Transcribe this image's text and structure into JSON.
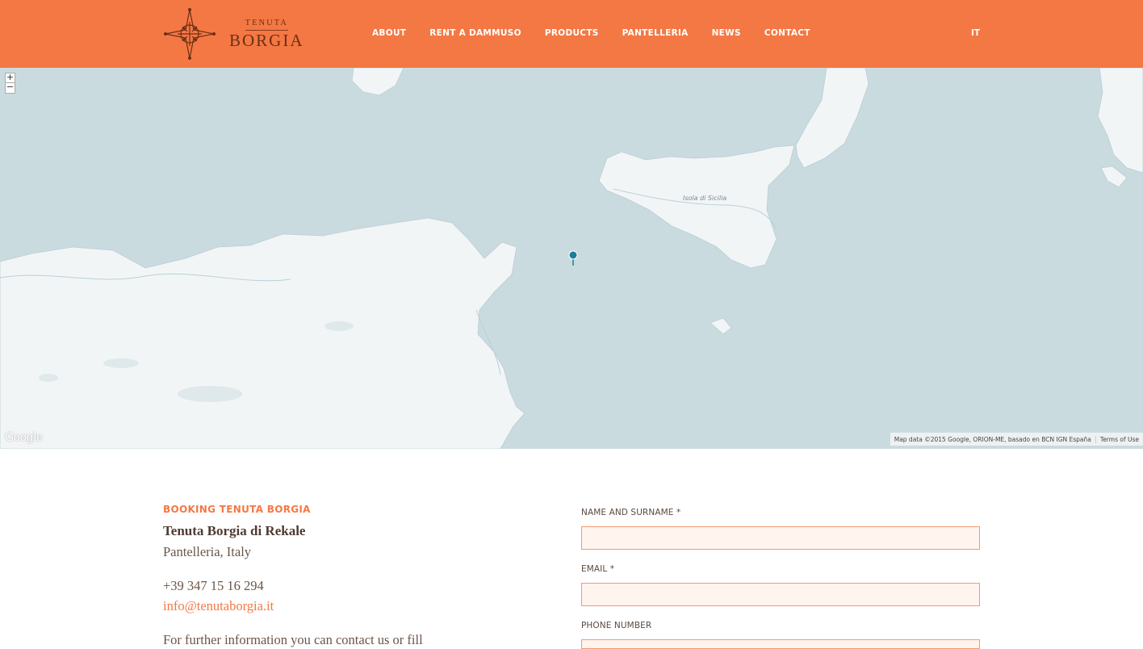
{
  "header": {
    "logo": {
      "top": "TENUTA",
      "bottom": "BORGIA"
    },
    "nav": [
      {
        "label": "ABOUT"
      },
      {
        "label": "RENT A DAMMUSO"
      },
      {
        "label": "PRODUCTS"
      },
      {
        "label": "PANTELLERIA"
      },
      {
        "label": "NEWS"
      },
      {
        "label": "CONTACT"
      }
    ],
    "language": "IT",
    "colors": {
      "brand": "#f47844",
      "logo": "#6b2e14"
    }
  },
  "map": {
    "zoom_in": "+",
    "zoom_out": "−",
    "place_label": "Isola di Sicilia",
    "provider": "Google",
    "credits": "Map data ©2015 Google, ORION-ME, basado en BCN IGN España",
    "terms": "Terms of Use",
    "marker_icon": "map-pin-icon",
    "colors": {
      "water": "#cadbe0",
      "land": "#f2f5f6",
      "marker": "#1a7f9a"
    }
  },
  "booking": {
    "title": "BOOKING TENUTA BORGIA",
    "company": "Tenuta Borgia di Rekale",
    "location": "Pantelleria, Italy",
    "phone": "+39 347 15 16 294",
    "email": "info@tenutaborgia.it",
    "info": "For further information you can contact us or fill"
  },
  "form": {
    "name_label": "NAME AND SURNAME *",
    "name_value": "",
    "email_label": "EMAIL *",
    "email_value": "",
    "phone_label": "PHONE NUMBER",
    "phone_value": ""
  }
}
